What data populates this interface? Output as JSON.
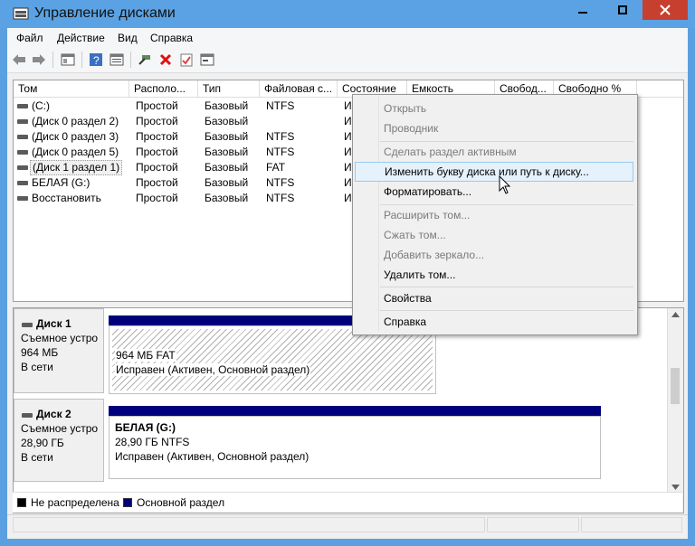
{
  "window": {
    "title": "Управление дисками"
  },
  "menubar": [
    "Файл",
    "Действие",
    "Вид",
    "Справка"
  ],
  "toolbar": {
    "icons": [
      "back-arrow-icon",
      "forward-arrow-icon",
      "console-tree-icon",
      "help-icon",
      "properties-icon",
      "connect-icon",
      "delete-icon",
      "checklist-icon",
      "rescan-icon"
    ]
  },
  "list": {
    "columns": [
      "Том",
      "Располо...",
      "Тип",
      "Файловая с...",
      "Состояние",
      "Емкость",
      "Свобод...",
      "Свободно %"
    ],
    "rows": [
      {
        "tom": "(C:)",
        "layout": "Простой",
        "type": "Базовый",
        "fs": "NTFS",
        "state": "И"
      },
      {
        "tom": "(Диск 0 раздел 2)",
        "layout": "Простой",
        "type": "Базовый",
        "fs": "",
        "state": "И"
      },
      {
        "tom": "(Диск 0 раздел 3)",
        "layout": "Простой",
        "type": "Базовый",
        "fs": "NTFS",
        "state": "И"
      },
      {
        "tom": "(Диск 0 раздел 5)",
        "layout": "Простой",
        "type": "Базовый",
        "fs": "NTFS",
        "state": "И"
      },
      {
        "tom": "(Диск 1 раздел 1)",
        "layout": "Простой",
        "type": "Базовый",
        "fs": "FAT",
        "state": "И"
      },
      {
        "tom": "БЕЛАЯ (G:)",
        "layout": "Простой",
        "type": "Базовый",
        "fs": "NTFS",
        "state": "И"
      },
      {
        "tom": "Восстановить",
        "layout": "Простой",
        "type": "Базовый",
        "fs": "NTFS",
        "state": "И"
      }
    ]
  },
  "disks": [
    {
      "name": "Диск 1",
      "kind": "Съемное устро",
      "size": "964 МБ",
      "status": "В сети",
      "partition": {
        "line1": "964 МБ FAT",
        "line2": "Исправен (Активен, Основной раздел)"
      }
    },
    {
      "name": "Диск 2",
      "kind": "Съемное устро",
      "size": "28,90 ГБ",
      "status": "В сети",
      "partition": {
        "title": "БЕЛАЯ  (G:)",
        "line1": "28,90 ГБ NTFS",
        "line2": "Исправен (Активен, Основной раздел)"
      }
    }
  ],
  "legend": [
    {
      "label": "Не распределена",
      "color": "#000000"
    },
    {
      "label": "Основной раздел",
      "color": "#00007d"
    }
  ],
  "context_menu": {
    "items": [
      {
        "label": "Открыть",
        "enabled": false
      },
      {
        "label": "Проводник",
        "enabled": false
      },
      {
        "label": "Сделать раздел активным",
        "enabled": false
      },
      {
        "label": "Изменить букву диска или путь к диску...",
        "enabled": true,
        "highlighted": true
      },
      {
        "label": "Форматировать...",
        "enabled": true
      },
      {
        "label": "Расширить том...",
        "enabled": false
      },
      {
        "label": "Сжать том...",
        "enabled": false
      },
      {
        "label": "Добавить зеркало...",
        "enabled": false
      },
      {
        "label": "Удалить том...",
        "enabled": true
      },
      {
        "label": "Свойства",
        "enabled": true
      },
      {
        "label": "Справка",
        "enabled": true
      }
    ]
  },
  "colors": {
    "titlebar": "#5aa2e3",
    "close": "#c7402f",
    "primary_partition": "#00007d",
    "highlight": "#e5f1fb"
  }
}
